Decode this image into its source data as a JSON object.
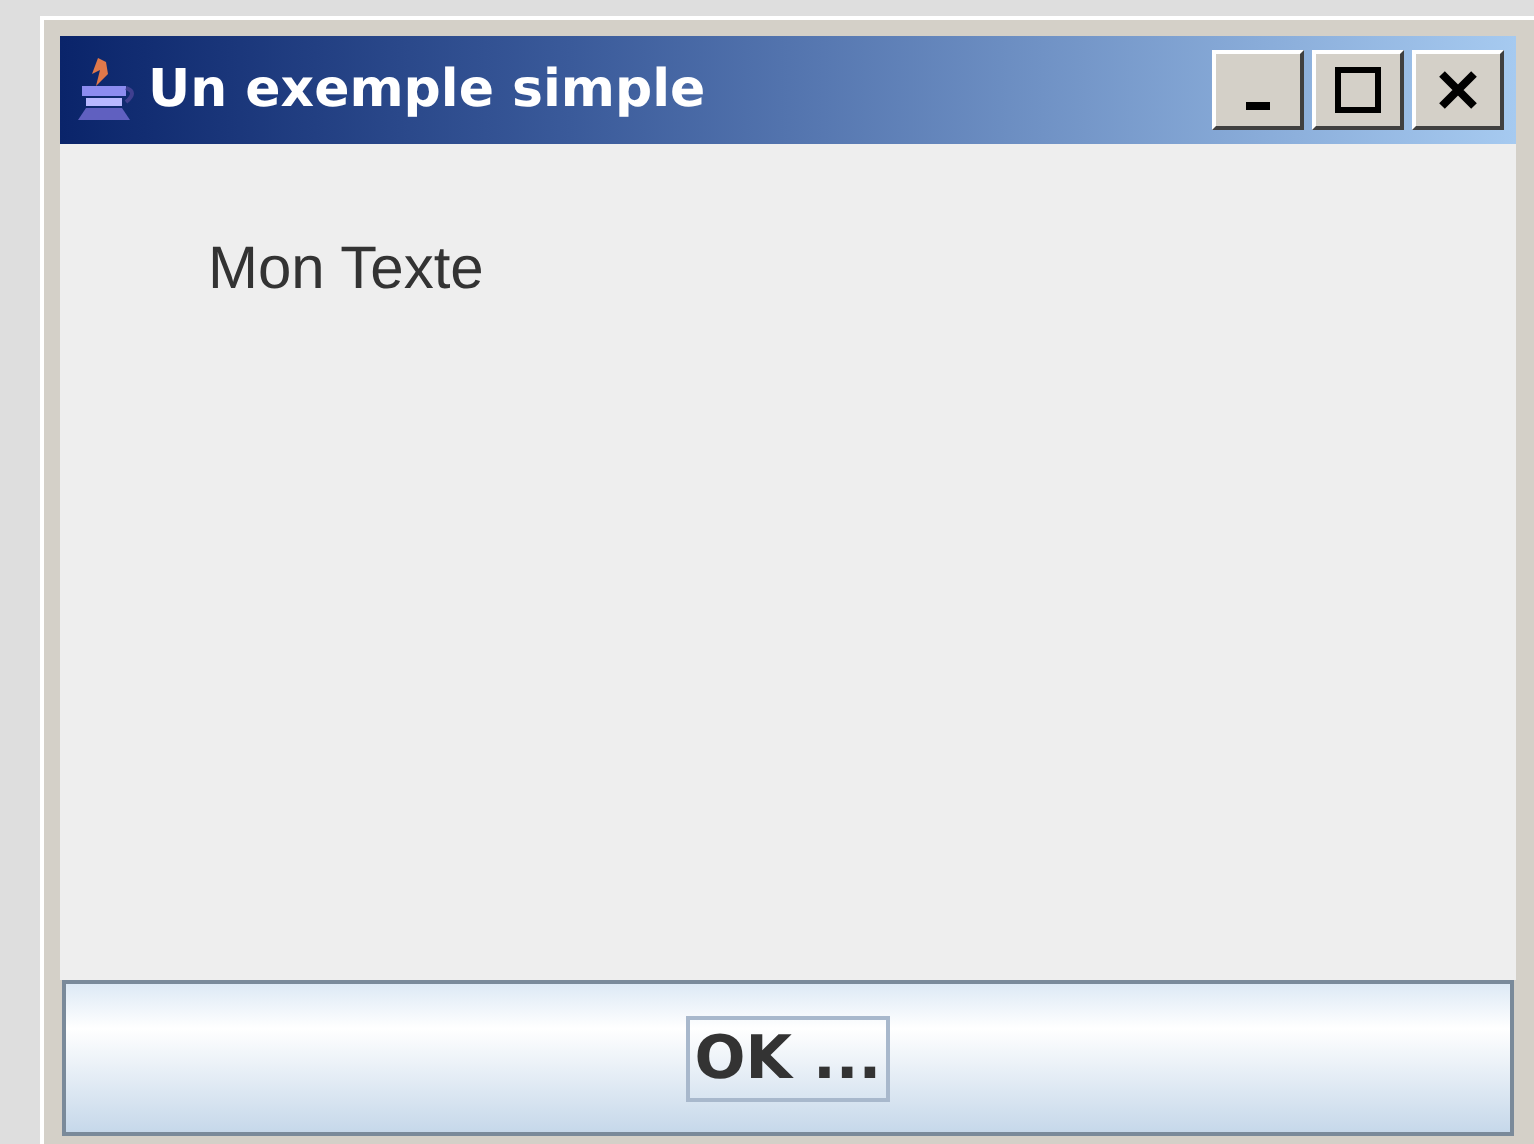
{
  "window": {
    "title": "Un exemple simple"
  },
  "label": "Mon Texte",
  "button": {
    "label": "OK ...",
    "focused": true
  }
}
